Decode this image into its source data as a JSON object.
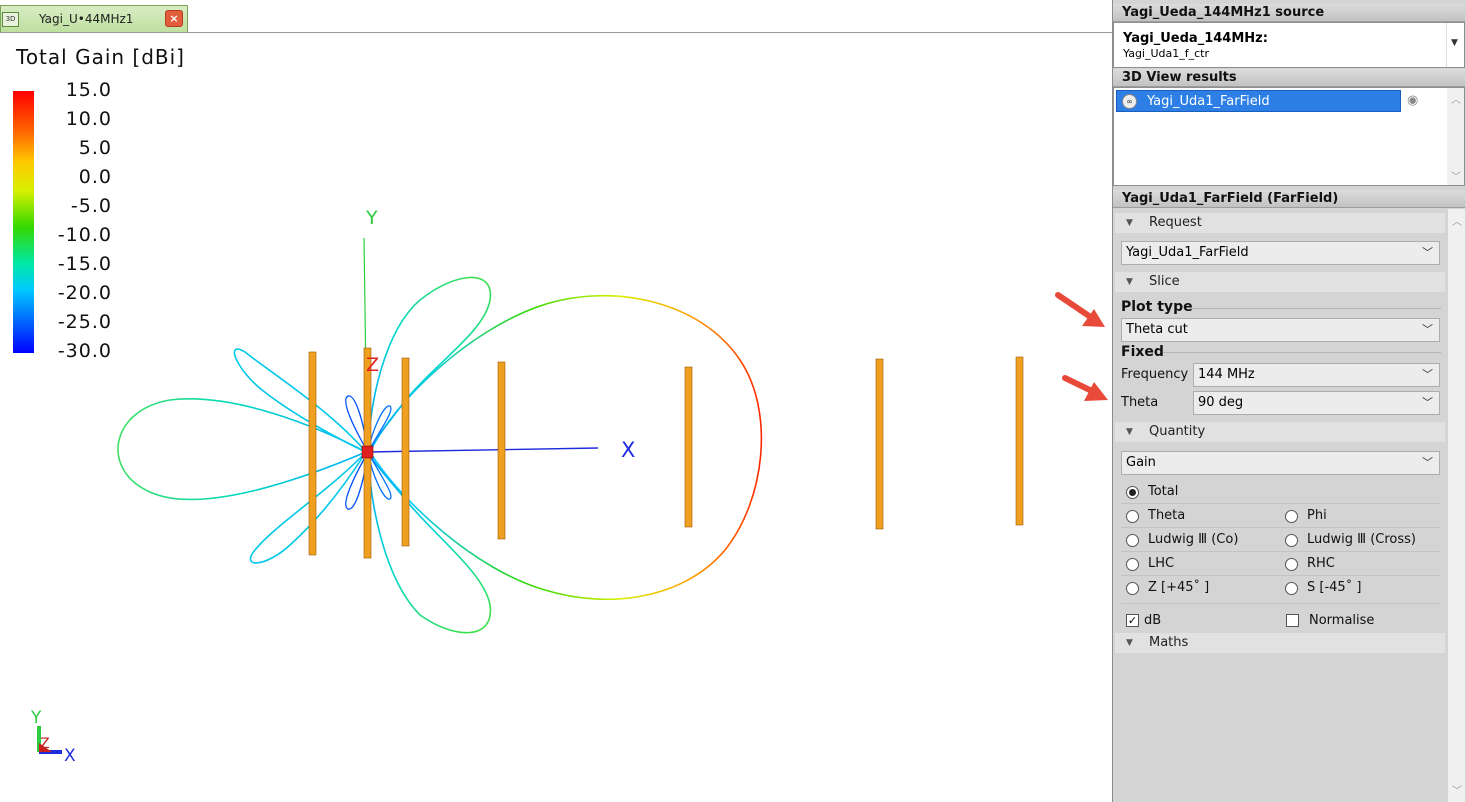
{
  "tab": {
    "badge": "3D",
    "title": "Yagi_U•44MHz1",
    "close": "×"
  },
  "legend": {
    "title": "Total Gain [dBi]",
    "ticks": [
      "15.0",
      "10.0",
      "5.0",
      "0.0",
      "-5.0",
      "-10.0",
      "-15.0",
      "-20.0",
      "-25.0",
      "-30.0"
    ]
  },
  "axes": {
    "y_label": "Y",
    "x_label": "X",
    "z_label": "Z",
    "triad_y": "Y",
    "triad_x": "X",
    "triad_z": "Z"
  },
  "colors": {
    "element": "#f0a020",
    "pattern_main": "#f08030",
    "axis_x": "#1f2cdc",
    "axis_y": "#2ecc40",
    "axis_z": "#e02020",
    "annotation_arrow": "#e84a3a"
  },
  "panel": {
    "source_header": "Yagi_Ueda_144MHz1 source",
    "source_title": "Yagi_Ueda_144MHz:",
    "source_sub": "Yagi_Uda1_f_ctr",
    "results_header": "3D View results",
    "result_item": "Yagi_Uda1_FarField",
    "farfield_header": "Yagi_Uda1_FarField (FarField)",
    "request": {
      "label": "Request",
      "value": "Yagi_Uda1_FarField"
    },
    "slice": {
      "label": "Slice",
      "plot_type_label": "Plot type",
      "plot_type_value": "Theta cut",
      "fixed_label": "Fixed",
      "frequency_label": "Frequency",
      "frequency_value": "144 MHz",
      "theta_label": "Theta",
      "theta_value": "90 deg"
    },
    "quantity": {
      "label": "Quantity",
      "value": "Gain",
      "options": [
        {
          "label": "Total",
          "selected": true
        },
        {
          "label": "Theta",
          "selected": false
        },
        {
          "label": "Phi",
          "selected": false
        },
        {
          "label": "Ludwig Ⅲ (Co)",
          "selected": false
        },
        {
          "label": "Ludwig Ⅲ (Cross)",
          "selected": false
        },
        {
          "label": "LHC",
          "selected": false
        },
        {
          "label": "RHC",
          "selected": false
        },
        {
          "label": "Z [+45˚ ]",
          "selected": false
        },
        {
          "label": "S [-45˚ ]",
          "selected": false
        }
      ],
      "db_label": "dB",
      "db_checked": true,
      "normalise_label": "Normalise",
      "normalise_checked": false
    },
    "maths": {
      "label": "Maths"
    }
  }
}
